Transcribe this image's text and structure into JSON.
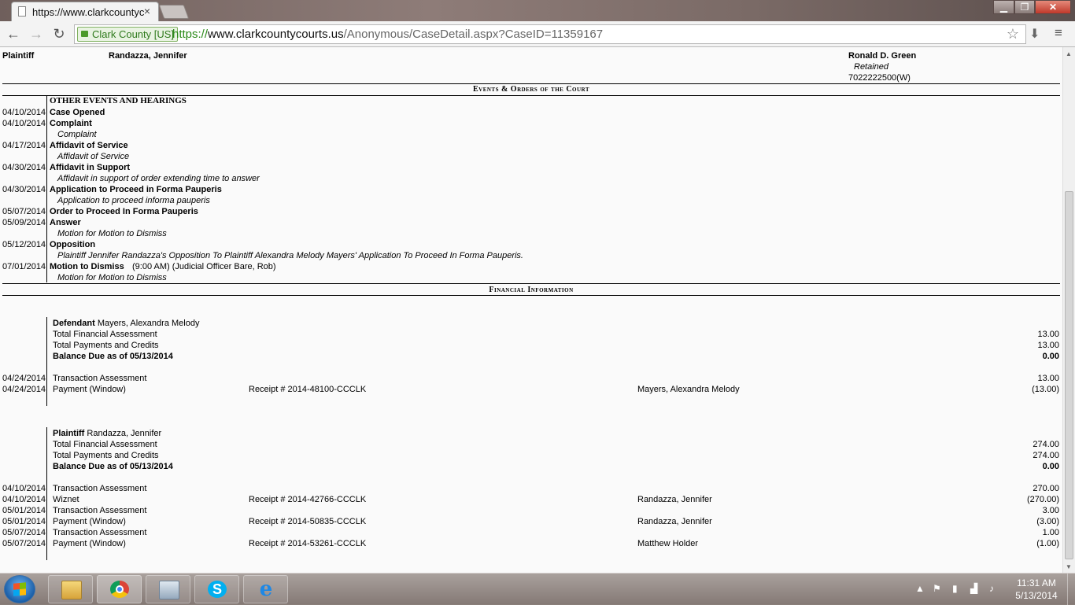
{
  "browser": {
    "tab_title": "https://www.clarkcountyc",
    "ev_label": "Clark County [US]",
    "url_scheme": "https://",
    "url_host": "www.clarkcountycourts.us",
    "url_path": "/Anonymous/CaseDetail.aspx?CaseID=11359167"
  },
  "party": {
    "role": "Plaintiff",
    "name": "Randazza, Jennifer",
    "attorney": "Ronald D. Green",
    "attorney_status": "Retained",
    "attorney_phone": "7022222500(W)"
  },
  "events": {
    "heading": "Events & Orders of the Court",
    "subheading": "OTHER EVENTS AND HEARINGS",
    "items": [
      {
        "date": "04/10/2014",
        "title": "Case Opened",
        "detail": "",
        "sub": ""
      },
      {
        "date": "04/10/2014",
        "title": "Complaint",
        "detail": "",
        "sub": "Complaint"
      },
      {
        "date": "04/17/2014",
        "title": "Affidavit of Service",
        "detail": "",
        "sub": "Affidavit of Service"
      },
      {
        "date": "04/30/2014",
        "title": "Affidavit in Support",
        "detail": "",
        "sub": "Affidavit in support of order extending time to answer"
      },
      {
        "date": "04/30/2014",
        "title": "Application to Proceed in Forma Pauperis",
        "detail": "",
        "sub": "Application to proceed informa pauperis"
      },
      {
        "date": "05/07/2014",
        "title": "Order to Proceed In Forma Pauperis",
        "detail": "",
        "sub": ""
      },
      {
        "date": "05/09/2014",
        "title": "Answer",
        "detail": "",
        "sub": "Motion for Motion to Dismiss"
      },
      {
        "date": "05/12/2014",
        "title": "Opposition",
        "detail": "",
        "sub": "Plaintiff Jennifer Randazza's Opposition To Plaintiff Alexandra Melody Mayers' Application To Proceed In Forma Pauperis."
      },
      {
        "date": "07/01/2014",
        "title": "Motion to Dismiss",
        "detail": "(9:00 AM) (Judicial Officer Bare, Rob)",
        "sub": "Motion for Motion to Dismiss"
      }
    ]
  },
  "financial": {
    "heading": "Financial Information",
    "groups": [
      {
        "role": "Defendant",
        "name": "Mayers, Alexandra Melody",
        "total_assessment_label": "Total Financial Assessment",
        "total_assessment": "13.00",
        "total_payments_label": "Total Payments and Credits",
        "total_payments": "13.00",
        "balance_label": "Balance Due as of 05/13/2014",
        "balance": "0.00",
        "transactions": [
          {
            "date": "04/24/2014",
            "type": "Transaction Assessment",
            "receipt": "",
            "payor": "",
            "amount": "13.00"
          },
          {
            "date": "04/24/2014",
            "type": "Payment (Window)",
            "receipt": "Receipt # 2014-48100-CCCLK",
            "payor": "Mayers, Alexandra Melody",
            "amount": "(13.00)"
          }
        ]
      },
      {
        "role": "Plaintiff",
        "name": "Randazza, Jennifer",
        "total_assessment_label": "Total Financial Assessment",
        "total_assessment": "274.00",
        "total_payments_label": "Total Payments and Credits",
        "total_payments": "274.00",
        "balance_label": "Balance Due as of 05/13/2014",
        "balance": "0.00",
        "transactions": [
          {
            "date": "04/10/2014",
            "type": "Transaction Assessment",
            "receipt": "",
            "payor": "",
            "amount": "270.00"
          },
          {
            "date": "04/10/2014",
            "type": "Wiznet",
            "receipt": "Receipt # 2014-42766-CCCLK",
            "payor": "Randazza, Jennifer",
            "amount": "(270.00)"
          },
          {
            "date": "05/01/2014",
            "type": "Transaction Assessment",
            "receipt": "",
            "payor": "",
            "amount": "3.00"
          },
          {
            "date": "05/01/2014",
            "type": "Payment (Window)",
            "receipt": "Receipt # 2014-50835-CCCLK",
            "payor": "Randazza, Jennifer",
            "amount": "(3.00)"
          },
          {
            "date": "05/07/2014",
            "type": "Transaction Assessment",
            "receipt": "",
            "payor": "",
            "amount": "1.00"
          },
          {
            "date": "05/07/2014",
            "type": "Payment (Window)",
            "receipt": "Receipt # 2014-53261-CCCLK",
            "payor": "Matthew Holder",
            "amount": "(1.00)"
          }
        ]
      }
    ]
  },
  "taskbar": {
    "time": "11:31 AM",
    "date": "5/13/2014",
    "apps": [
      "file-explorer",
      "chrome",
      "network-settings",
      "skype",
      "internet-explorer"
    ]
  },
  "colors": {
    "ev_green": "#2a8a18",
    "close_red": "#c0392b"
  }
}
